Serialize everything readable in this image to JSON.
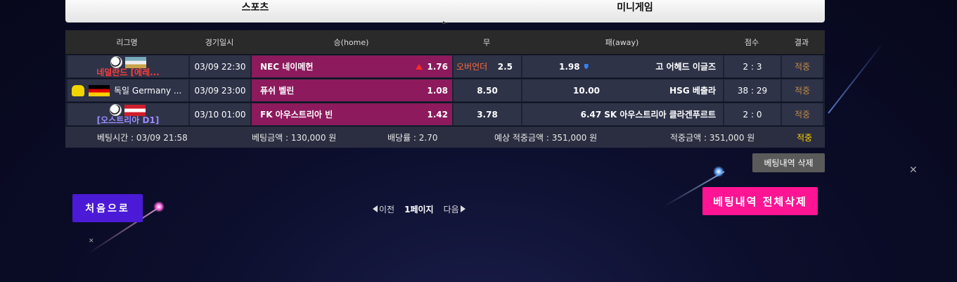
{
  "tabs": [
    "스포츠",
    "미니게임"
  ],
  "table": {
    "headers": [
      "리그명",
      "경기일시",
      "승(home)",
      "무",
      "패(away)",
      "점수",
      "결과"
    ],
    "rows": [
      {
        "league": "네덜란드 [에레...",
        "league_icons": [
          "soccer-ball-icon",
          "netherlands-flag-icon"
        ],
        "time": "03/09 22:30",
        "home_team": "NEC 네이메헌",
        "home_odds": "1.76",
        "draw_label": "오버언더",
        "draw_value": "2.5",
        "away_odds": "1.98",
        "away_team": "고 어헤드 이글즈",
        "score": "2 : 3",
        "result": "적중"
      },
      {
        "league": "독일 Germany ...",
        "league_icons": [
          "jersey-icon",
          "germany-flag-icon"
        ],
        "time": "03/09 23:00",
        "home_team": "퓨쉬 벨린",
        "home_odds": "1.08",
        "draw_value": "8.50",
        "away_odds": "10.00",
        "away_team": "HSG 베출라",
        "score": "38 : 29",
        "result": "적중"
      },
      {
        "league": "[오스트리아 D1]",
        "league_icons": [
          "soccer-ball-icon",
          "austria-flag-icon"
        ],
        "time": "03/10 01:00",
        "home_team": "FK 아우스트리아 빈",
        "home_odds": "1.42",
        "draw_value": "3.78",
        "away_odds": "6.47",
        "away_team": "SK 아우스트리아 클라겐푸르트",
        "score": "2 : 0",
        "result": "적중"
      }
    ]
  },
  "summary": {
    "bet_time": "베팅시간 : 03/09 21:58",
    "bet_amount": "베팅금액 : 130,000 원",
    "odds": "배당률 : 2.70",
    "expected": "예상 적중금액 : 351,000 원",
    "won": "적중금액 : 351,000 원",
    "status": "적중"
  },
  "buttons": {
    "delete_history": "베팅내역 삭제",
    "first": "처음으로",
    "delete_all": "베팅내역 전체삭제"
  },
  "pager": {
    "prev": "이전",
    "current": "1페이지",
    "next": "다음"
  },
  "colors": {
    "home_cell": "#8c1a5d",
    "result_text": "#c58a43",
    "status_text": "#ffd200",
    "first_button": "#4a1ad6",
    "delete_all_button": "#ff1493"
  }
}
